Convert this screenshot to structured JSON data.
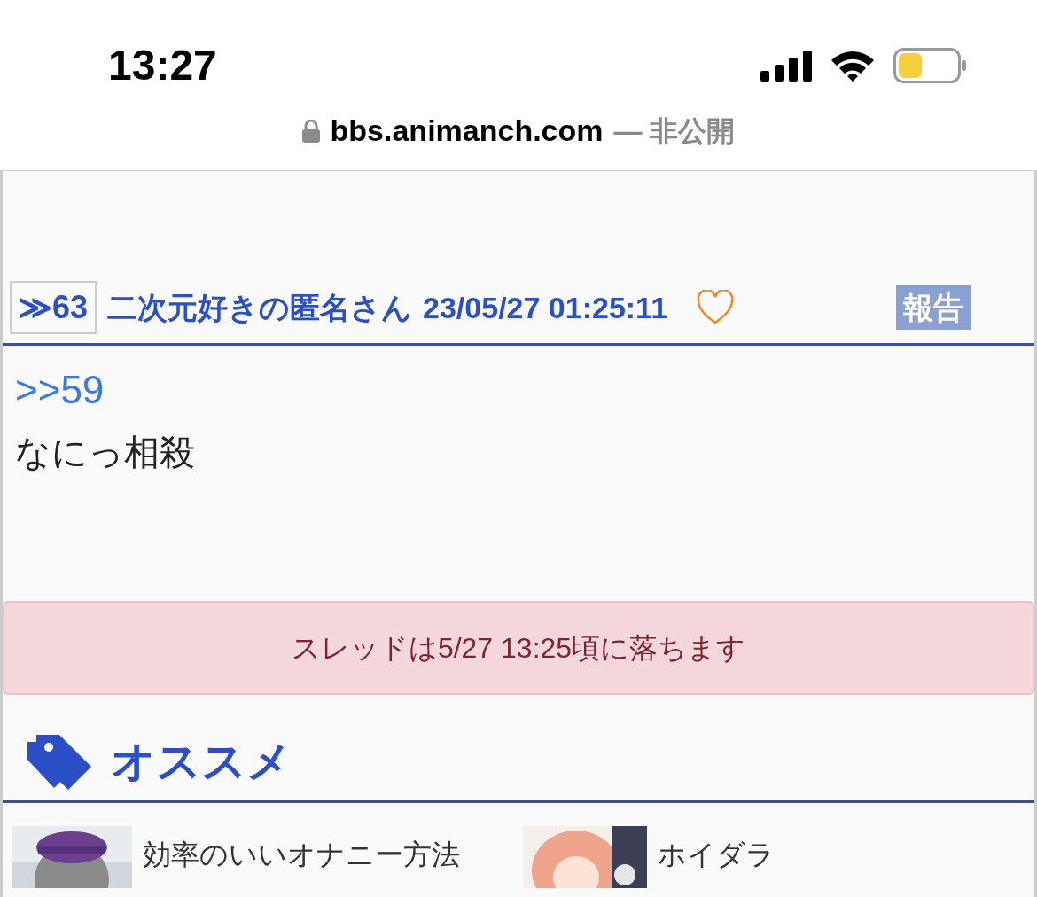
{
  "status_bar": {
    "time": "13:27"
  },
  "address_bar": {
    "domain": "bbs.animanch.com",
    "suffix": "— 非公開"
  },
  "post": {
    "number": "≫63",
    "author": "二次元好きの匿名さん",
    "date": "23/05/27 01:25:11",
    "liked": false,
    "report": "報告",
    "reply_link": ">>59",
    "body": "なにっ相殺"
  },
  "notice": "スレッドは5/27 13:25頃に落ちます",
  "recommend": {
    "title": "オススメ",
    "items": [
      {
        "title": "効率のいいオナニー方法",
        "kind": "figure"
      },
      {
        "title": "ホイダラ",
        "kind": "girl"
      }
    ]
  }
}
